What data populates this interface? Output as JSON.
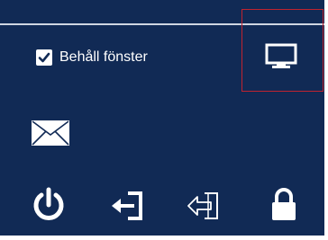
{
  "options": {
    "keep_window_label": "Behåll fönster",
    "keep_window_checked": true
  },
  "icons": {
    "display": "monitor-icon",
    "mail": "mail-icon",
    "power": "power-icon",
    "logout": "logout-icon",
    "logout_dim": "logout-outline-icon",
    "lock": "lock-icon"
  },
  "colors": {
    "background": "#112a55",
    "highlight": "#c0232f",
    "foreground": "#ffffff"
  }
}
